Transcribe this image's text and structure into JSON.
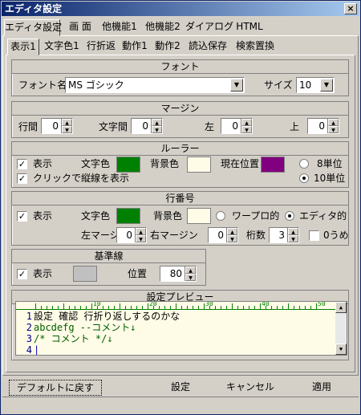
{
  "window": {
    "title": "エディタ設定",
    "close_label": "×"
  },
  "tabs_top": [
    "エディタ設定",
    "画 面",
    "他機能1",
    "他機能2",
    "ダイアログ",
    "HTML"
  ],
  "tabs_sub": [
    "表示1",
    "文字色1",
    "行折返",
    "動作1",
    "動作2",
    "読込保存",
    "検索置換"
  ],
  "font": {
    "heading": "フォント",
    "name_label": "フォント名",
    "name_value": "MS ゴシック",
    "size_label": "サイズ",
    "size_value": "10"
  },
  "margin": {
    "heading": "マージン",
    "line_label": "行間",
    "line_value": "0",
    "char_label": "文字間",
    "char_value": "0",
    "left_label": "左",
    "left_value": "0",
    "top_label": "上",
    "top_value": "0"
  },
  "ruler": {
    "heading": "ルーラー",
    "show_label": "表示",
    "text_color_label": "文字色",
    "bg_label": "背景色",
    "cursor_label": "現在位置",
    "unit8_label": "8単位",
    "unit10_label": "10単位",
    "click_label": "クリックで縦線を表示",
    "text_color": "#008000",
    "bg_color": "#fefbe6",
    "cursor_color": "#800080"
  },
  "linenum": {
    "heading": "行番号",
    "show_label": "表示",
    "text_color_label": "文字色",
    "bg_label": "背景色",
    "wrap_label": "ワープロ的",
    "editor_label": "エディタ的",
    "left_margin_label": "左マージン",
    "left_margin_value": "0",
    "right_margin_label": "右マージン",
    "right_margin_value": "0",
    "digits_label": "桁数",
    "digits_value": "3",
    "zero_label": "0うめ",
    "text_color": "#008000",
    "bg_color": "#fefbe6"
  },
  "baseline": {
    "heading": "基準線",
    "show_label": "表示",
    "pos_label": "位置",
    "pos_value": "80",
    "color": "#c0c0c0"
  },
  "preview": {
    "heading": "設定プレビュー",
    "ruler_numbers": [
      "10",
      "20",
      "30",
      "40",
      "50"
    ],
    "lines": [
      {
        "num": "1",
        "text": "設定  確認          行折り返しするのかな"
      },
      {
        "num": "2",
        "text": "abcdefg --コメント↓"
      },
      {
        "num": "3",
        "text": "/* コメント */↓"
      },
      {
        "num": "4",
        "text": "|"
      }
    ]
  },
  "buttons": {
    "default": "デフォルトに戻す",
    "ok": "設定",
    "cancel": "キャンセル",
    "apply": "適用"
  }
}
